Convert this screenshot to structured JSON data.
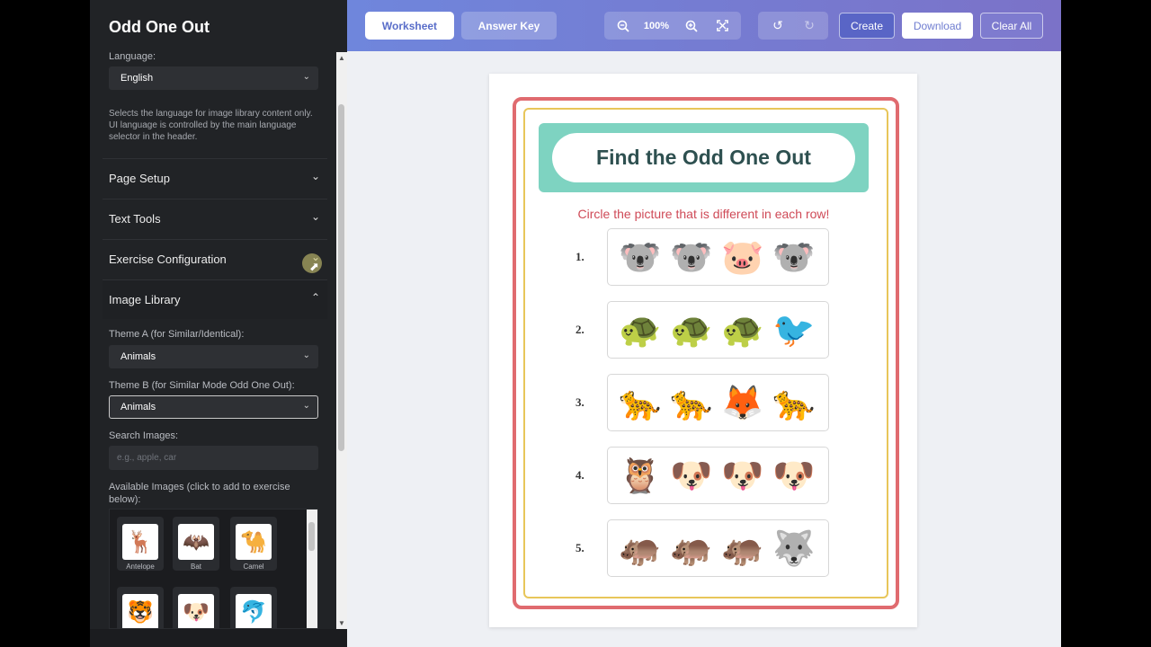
{
  "sidebar": {
    "title": "Odd One Out",
    "language_label": "Language:",
    "language_value": "English",
    "language_help": "Selects the language for image library content only. UI language is controlled by the main language selector in the header.",
    "sections": [
      {
        "label": "Page Setup",
        "state": "collapsed"
      },
      {
        "label": "Text Tools",
        "state": "collapsed"
      },
      {
        "label": "Exercise Configuration",
        "state": "collapsed"
      },
      {
        "label": "Image Library",
        "state": "expanded"
      }
    ],
    "theme_a_label": "Theme A (for Similar/Identical):",
    "theme_a_value": "Animals",
    "theme_b_label": "Theme B (for Similar Mode Odd One Out):",
    "theme_b_value": "Animals",
    "search_label": "Search Images:",
    "search_placeholder": "e.g., apple, car",
    "available_label": "Available Images (click to add to exercise below):",
    "images": [
      {
        "name": "Antelope",
        "icon": "🦌"
      },
      {
        "name": "Bat",
        "icon": "🦇"
      },
      {
        "name": "Camel",
        "icon": "🐪"
      },
      {
        "name": "",
        "icon": "🐯"
      },
      {
        "name": "",
        "icon": "🐶"
      },
      {
        "name": "",
        "icon": "🐬"
      }
    ]
  },
  "toolbar": {
    "tab_worksheet": "Worksheet",
    "tab_answer_key": "Answer Key",
    "zoom_out_icon": "zoom-out-icon",
    "zoom_value": "100%",
    "zoom_in_icon": "zoom-in-icon",
    "fit_icon": "fit-screen-icon",
    "undo_icon": "undo-icon",
    "redo_icon": "redo-icon",
    "create_label": "Create",
    "download_label": "Download",
    "clear_label": "Clear All"
  },
  "worksheet": {
    "title": "Find the Odd One Out",
    "instruction": "Circle the picture that is different in each row!",
    "rows": [
      {
        "number": "1.",
        "items": [
          "🐨",
          "🐨",
          "🐷",
          "🐨"
        ]
      },
      {
        "number": "2.",
        "items": [
          "🐢",
          "🐢",
          "🐢",
          "🐦"
        ]
      },
      {
        "number": "3.",
        "items": [
          "🐆",
          "🐆",
          "🦊",
          "🐆"
        ]
      },
      {
        "number": "4.",
        "items": [
          "🦉",
          "🐶",
          "🐶",
          "🐶"
        ]
      },
      {
        "number": "5.",
        "items": [
          "🦛",
          "🦛",
          "🦛",
          "🐺"
        ]
      }
    ]
  },
  "colors": {
    "accent": "#6f86dc",
    "banner": "#7ed3c1",
    "border_red": "#e06b6f",
    "border_gold": "#e8c65a",
    "instruction": "#cf4a57"
  }
}
